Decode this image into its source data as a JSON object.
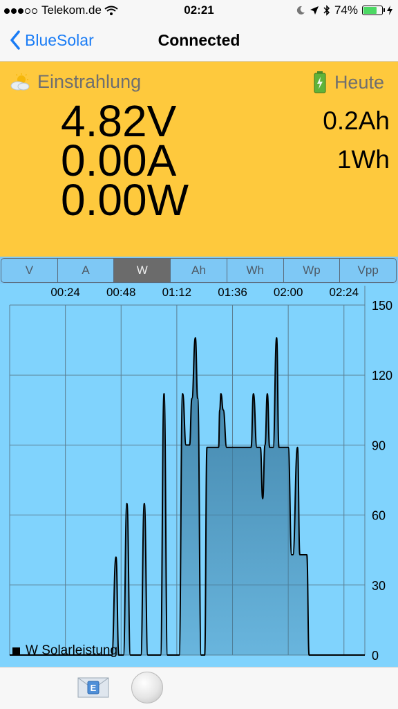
{
  "status_bar": {
    "carrier": "Telekom.de",
    "time": "02:21",
    "battery": "74%",
    "battery_level": 0.74
  },
  "nav": {
    "back_label": "BlueSolar",
    "title": "Connected"
  },
  "panel": {
    "left_header": "Einstrahlung",
    "right_header": "Heute",
    "voltage": "4.82V",
    "current": "0.00A",
    "power": "0.00W",
    "today_charge": "0.2Ah",
    "today_energy": "1Wh",
    "accent_color": "#fec93d"
  },
  "segments": {
    "items": [
      "V",
      "A",
      "W",
      "Ah",
      "Wh",
      "Wp",
      "Vpp"
    ],
    "selected": "W"
  },
  "chart_data": {
    "type": "area",
    "title": "",
    "x_ticks": [
      "00:24",
      "00:48",
      "01:12",
      "01:36",
      "02:00",
      "02:24"
    ],
    "y_ticks": [
      "0",
      "30",
      "60",
      "90",
      "120",
      "150"
    ],
    "ylim": [
      0,
      150
    ],
    "xlim_minutes": [
      0,
      153
    ],
    "grid": true,
    "legend": "bottom-left",
    "series": [
      {
        "name": "W Solarleistung",
        "color": "#000000",
        "fill_color": "#3d7ea3",
        "x_minutes": [
          0,
          43,
          44,
          45.8,
          47,
          47.5,
          48,
          49,
          50.5,
          52,
          52.5,
          55,
          56.5,
          58,
          59.5,
          61,
          63,
          64.2,
          65,
          66.5,
          68,
          70,
          72,
          73,
          74.5,
          76,
          77.5,
          78.5,
          80,
          81,
          82.5,
          83.5,
          84,
          85,
          90,
          90.5,
          91,
          92,
          93.5,
          95,
          95.5,
          96,
          103,
          104,
          105,
          106.5,
          108,
          109,
          110,
          111,
          112,
          113.5,
          115,
          116,
          117,
          118.5,
          120,
          121.5,
          122,
          124,
          125,
          126.5,
          128,
          129,
          129.5,
          130,
          130.5,
          132,
          138,
          153
        ],
        "values": [
          0,
          0,
          0,
          42,
          0,
          0,
          0,
          0,
          65,
          0,
          0,
          0,
          0,
          65,
          0,
          0,
          0,
          0,
          0,
          112,
          0,
          0,
          0,
          0,
          112,
          90,
          90,
          110,
          136,
          110,
          0,
          0,
          0,
          89,
          89,
          105,
          112,
          105,
          89,
          89,
          89,
          89,
          89,
          89,
          112,
          89,
          89,
          67,
          90,
          112,
          89,
          89,
          136,
          89,
          89,
          89,
          89,
          43,
          43,
          89,
          43,
          43,
          43,
          0,
          0,
          0,
          0,
          0,
          0,
          0
        ]
      }
    ]
  }
}
